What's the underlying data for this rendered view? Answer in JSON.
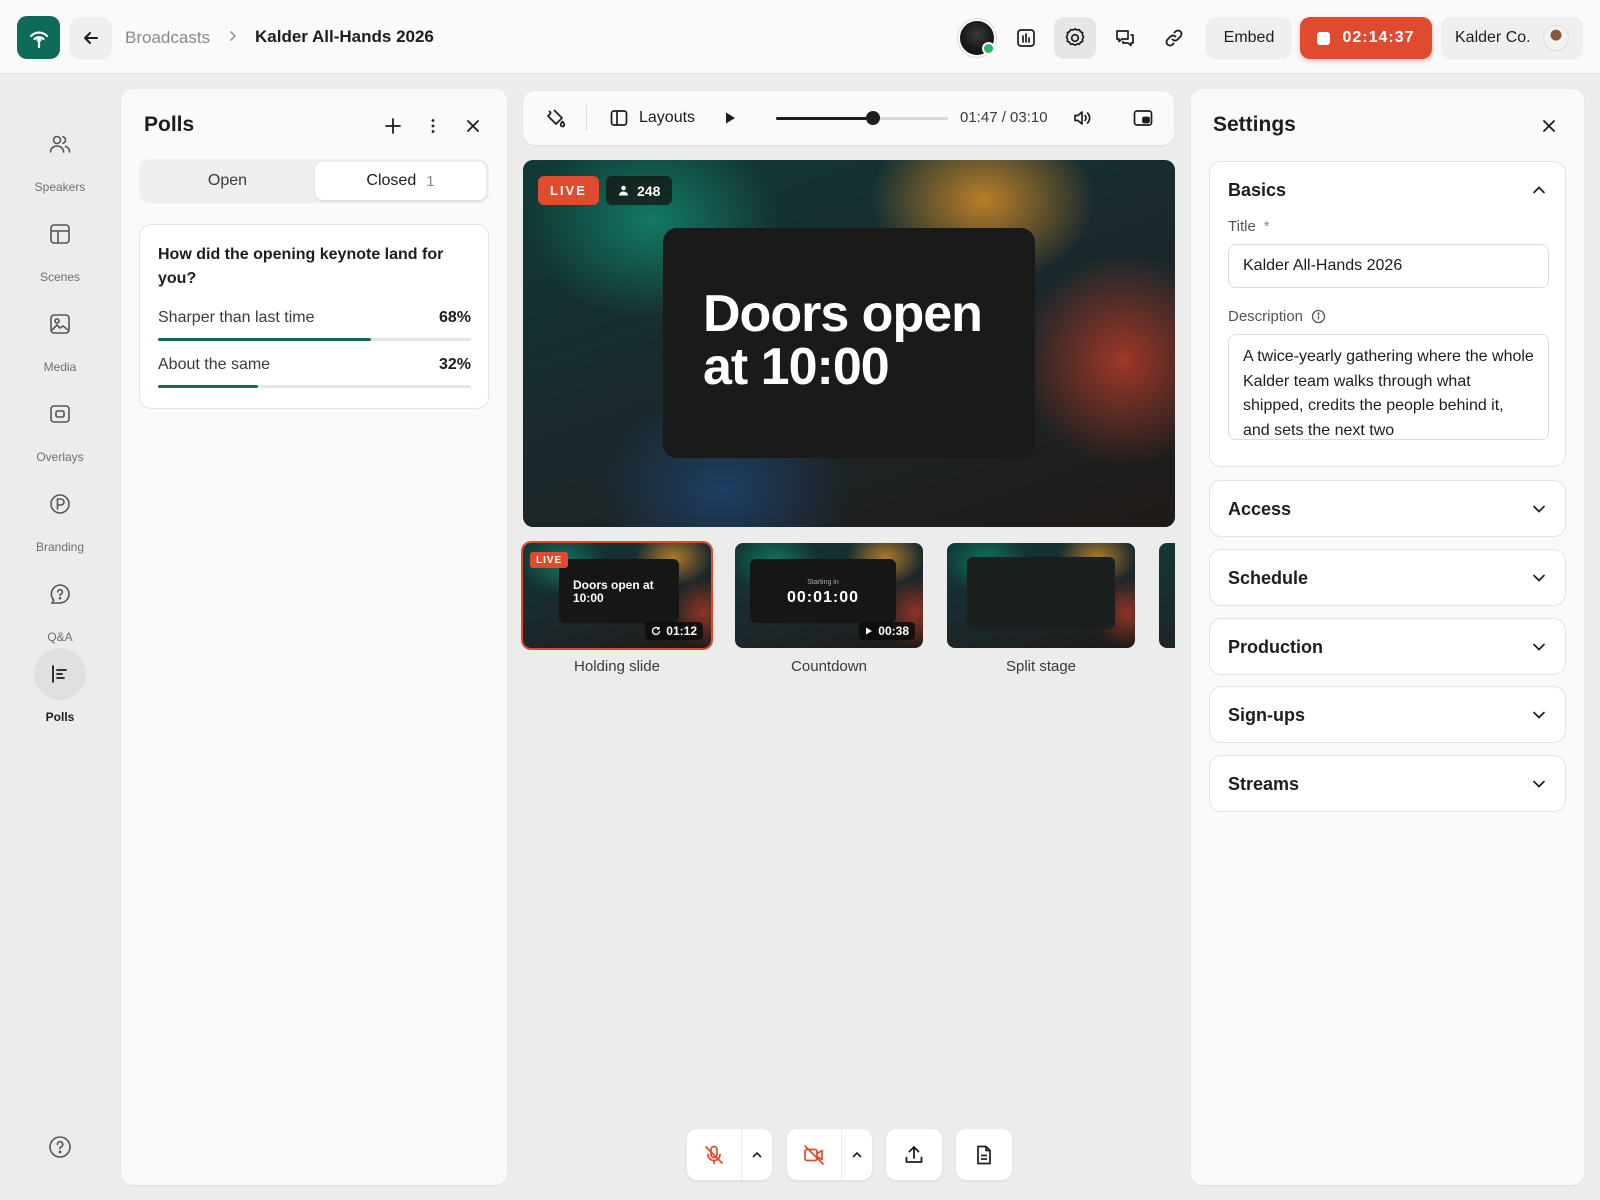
{
  "header": {
    "breadcrumb_parent": "Broadcasts",
    "breadcrumb_current": "Kalder All-Hands 2026",
    "embed_label": "Embed",
    "recording_time": "02:14:37",
    "org_name": "Kalder Co."
  },
  "rail": {
    "items": [
      {
        "label": "Speakers",
        "icon": "users-icon"
      },
      {
        "label": "Scenes",
        "icon": "layout-icon"
      },
      {
        "label": "Media",
        "icon": "image-icon"
      },
      {
        "label": "Overlays",
        "icon": "overlay-icon"
      },
      {
        "label": "Branding",
        "icon": "brand-icon"
      },
      {
        "label": "Q&A",
        "icon": "question-bubble-icon"
      },
      {
        "label": "Polls",
        "icon": "polls-icon"
      }
    ],
    "active": "Polls"
  },
  "polls": {
    "title": "Polls",
    "tab_open": "Open",
    "tab_closed": "Closed",
    "closed_count": "1",
    "question": "How did the opening keynote land for you?",
    "options": [
      {
        "label": "Sharper than last time",
        "pct": "68%",
        "value": 0.68
      },
      {
        "label": "About the same",
        "pct": "32%",
        "value": 0.32
      }
    ]
  },
  "player": {
    "layouts_label": "Layouts",
    "time": "01:47 / 03:10",
    "progress": 0.5632
  },
  "stage": {
    "live_label": "LIVE",
    "viewers": "248",
    "slide_text": "Doors open at 10:00"
  },
  "scenes": [
    {
      "label": "Holding slide",
      "live_tag": "LIVE",
      "title": "Doors open at 10:00",
      "time": "01:12"
    },
    {
      "label": "Countdown",
      "small": "Starting in",
      "count": "00:01:00",
      "time": "00:38"
    },
    {
      "label": "Split stage"
    }
  ],
  "settings": {
    "title": "Settings",
    "basics": {
      "title": "Basics",
      "title_label": "Title",
      "title_required": "*",
      "title_value": "Kalder All-Hands 2026",
      "description_label": "Description",
      "description_value": "A twice-yearly gathering where the whole Kalder team walks through what shipped, credits the people behind it, and sets the next two"
    },
    "sections": [
      "Access",
      "Schedule",
      "Production",
      "Sign-ups",
      "Streams"
    ]
  },
  "colors": {
    "brand": "#0d6b57",
    "live": "#e04a2f"
  }
}
